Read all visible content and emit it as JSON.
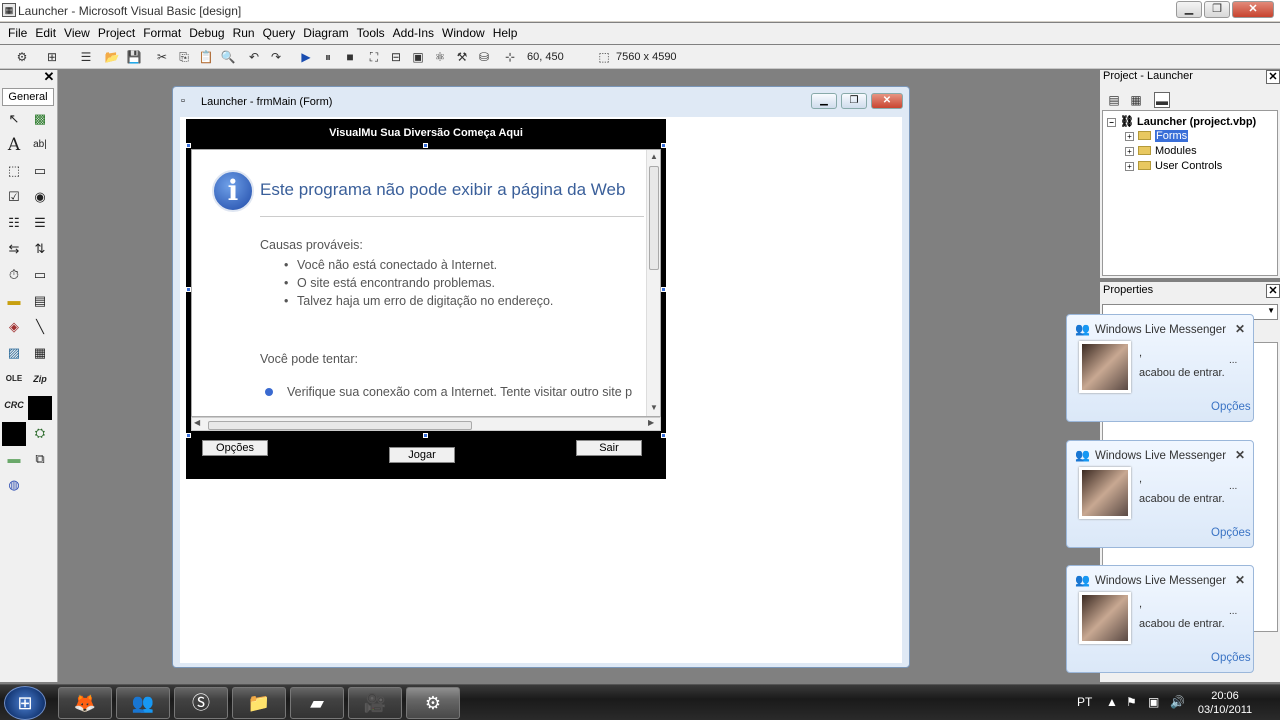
{
  "window": {
    "title": "Launcher - Microsoft Visual Basic [design]"
  },
  "menu": [
    "File",
    "Edit",
    "View",
    "Project",
    "Format",
    "Debug",
    "Run",
    "Query",
    "Diagram",
    "Tools",
    "Add-Ins",
    "Window",
    "Help"
  ],
  "toolbar": {
    "position": "60, 450",
    "size": "7560 x 4590"
  },
  "toolbox": {
    "tab": "General",
    "tools": [
      "pointer-icon",
      "picture-icon",
      "label-icon",
      "textbox-icon",
      "frame-icon",
      "button-icon",
      "checkbox-icon",
      "option-icon",
      "combo-icon",
      "list-icon",
      "hscroll-icon",
      "vscroll-icon",
      "timer-icon",
      "drive-icon",
      "dir-icon",
      "file-icon",
      "shape-icon",
      "line-icon",
      "image-icon",
      "data-icon",
      "ole-icon",
      "zip-icon",
      "crc-icon",
      "black-icon",
      "black2-icon",
      "inet-icon",
      "winsock-icon",
      "globe-icon"
    ],
    "labels": {
      "zip": "Zip",
      "crc": "CRC",
      "ole": "OLE"
    }
  },
  "form": {
    "title": "Launcher - frmMain (Form)",
    "panel_title": "VisualMu Sua Diversão Começa Aqui",
    "browser": {
      "heading": "Este programa não pode exibir a página da Web",
      "causes_label": "Causas prováveis:",
      "causes": [
        "Você não está conectado à Internet.",
        "O site está encontrando problemas.",
        "Talvez haja um erro de digitação no endereço."
      ],
      "try_label": "Você pode tentar:",
      "try_item": "Verifique sua conexão com a Internet. Tente visitar outro site p"
    },
    "buttons": {
      "options": "Opções",
      "play": "Jogar",
      "exit": "Sair"
    }
  },
  "project": {
    "title": "Project - Launcher",
    "root": "Launcher (project.vbp)",
    "folders": [
      "Forms",
      "Modules",
      "User Controls"
    ]
  },
  "properties": {
    "title": "Properties"
  },
  "messenger": [
    {
      "title": "Windows Live Messenger",
      "dots1": ",",
      "dots2": "...",
      "text": "acabou de entrar.",
      "link": "Opções"
    },
    {
      "title": "Windows Live Messenger",
      "dots1": ",",
      "dots2": "...",
      "text": "acabou de entrar.",
      "link": "Opções"
    },
    {
      "title": "Windows Live Messenger",
      "dots1": ",",
      "dots2": "...",
      "text": "acabou de entrar.",
      "link": "Opções"
    }
  ],
  "taskbar": {
    "lang": "PT",
    "time": "20:06",
    "date": "03/10/2011"
  }
}
